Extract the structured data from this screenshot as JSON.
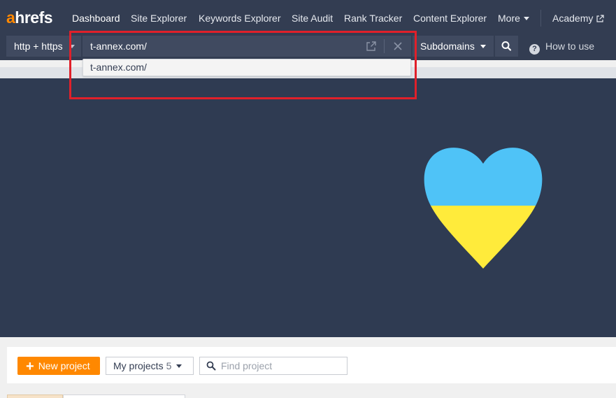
{
  "brand": {
    "logo_prefix": "a",
    "logo_rest": "hrefs",
    "accent": "#ff8800",
    "nav_bg": "#333d52"
  },
  "nav": {
    "items": [
      "Dashboard",
      "Site Explorer",
      "Keywords Explorer",
      "Site Audit",
      "Rank Tracker",
      "Content Explorer"
    ],
    "more_label": "More",
    "academy_label": "Academy",
    "active": "Dashboard"
  },
  "search": {
    "protocol": "http + https",
    "url_value": "t-annex.com/",
    "mode": "Subdomains",
    "how_to_use": "How to use",
    "suggestion": "t-annex.com/"
  },
  "banner": {
    "heart_top_color": "#4fc3f7",
    "heart_bottom_color": "#ffeb3b"
  },
  "projects": {
    "new_project_label": "New project",
    "my_projects_label": "My projects",
    "my_projects_count": "5",
    "find_placeholder": "Find project"
  }
}
